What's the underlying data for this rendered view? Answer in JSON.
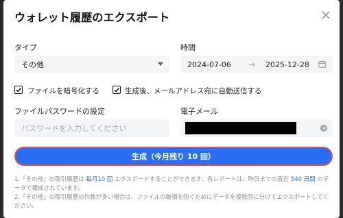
{
  "modal": {
    "title": "ウォレット履歴のエクスポート"
  },
  "type": {
    "label": "タイプ",
    "selected": "その他"
  },
  "time": {
    "label": "時間",
    "start": "2024-07-06",
    "end": "2025-12-28"
  },
  "options": {
    "encrypt_label": "ファイルを暗号化する",
    "encrypt_checked": true,
    "email_label": "生成後、メールアドレス宛に自動送信する",
    "email_checked": true
  },
  "password": {
    "label": "ファイルパスワードの設定",
    "placeholder": "パスワードを入力してください"
  },
  "email": {
    "label": "電子メール",
    "value": ""
  },
  "generate": {
    "label": "生成（今月残り 10 回）"
  },
  "notes": {
    "line1_a": "1.「その他」の取引履歴は ",
    "line1_b": "毎月10 回",
    "line1_c": " エクスポートすることができます。各レポートは、昨日までの直近 ",
    "line1_d": "540 日間",
    "line1_e": " のデータで構成されています。",
    "line2": "2.「その他」の取引履歴の件数が多い場合は、ファイルの破損を防ぐためにデータを複数回に分けてエクスポートしてください。"
  },
  "colors": {
    "accent": "#2a6ff3",
    "button_border": "#d9534f"
  },
  "icons": {
    "close": "close-icon",
    "dropdown": "chevron-down-icon",
    "arrow": "arrow-right-icon",
    "calendar": "calendar-icon",
    "clear": "clear-icon",
    "check": "check-icon"
  }
}
